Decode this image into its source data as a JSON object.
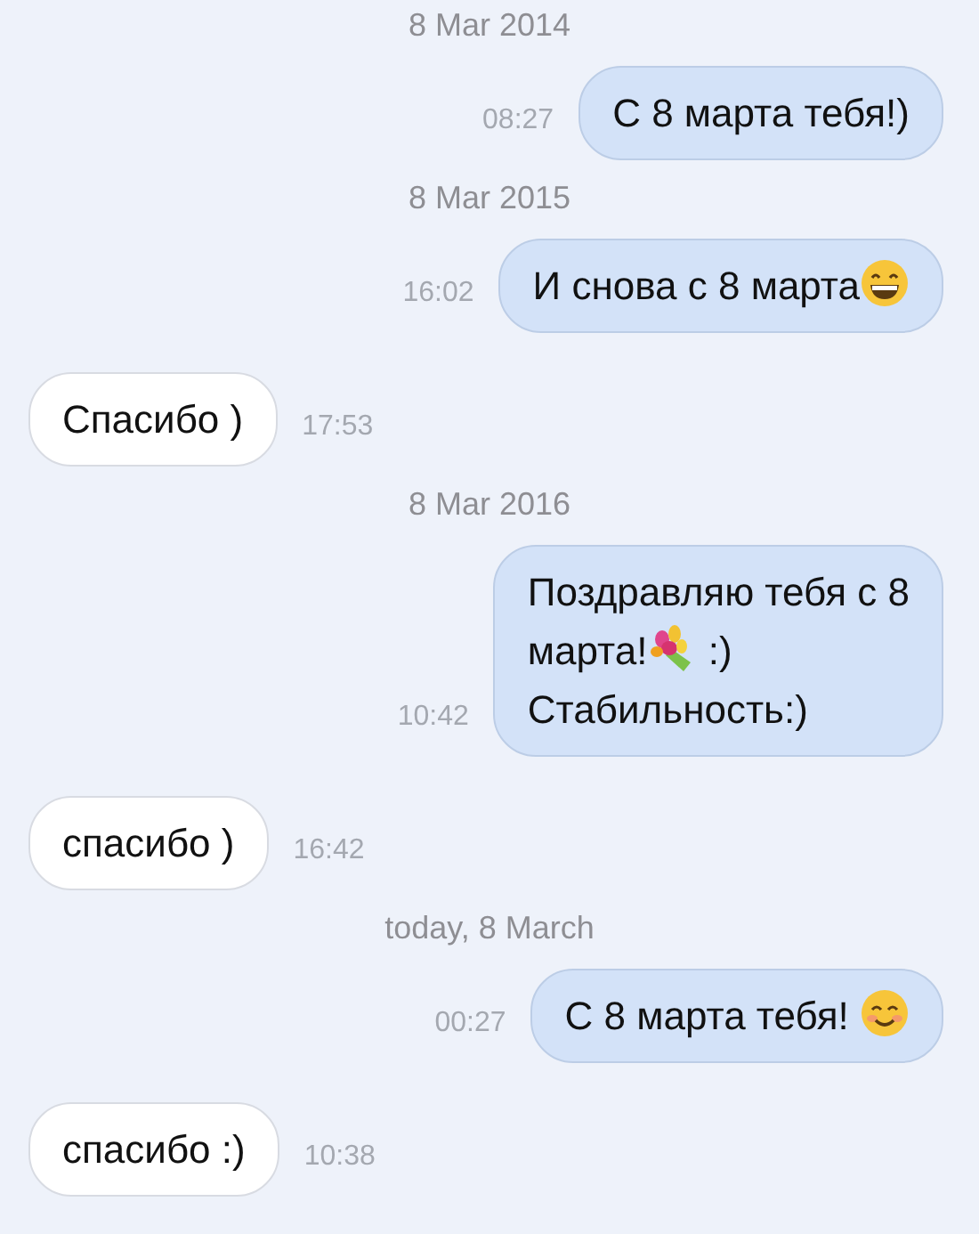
{
  "thread": [
    {
      "kind": "date",
      "text": "8 Mar 2014"
    },
    {
      "kind": "message",
      "outgoing": true,
      "time": "08:27",
      "lines": [
        [
          {
            "kind": "text",
            "text": "С 8 марта тебя!)"
          }
        ]
      ]
    },
    {
      "kind": "date",
      "text": "8 Mar 2015"
    },
    {
      "kind": "message",
      "outgoing": true,
      "time": "16:02",
      "lines": [
        [
          {
            "kind": "text",
            "text": "И снова с 8 марта"
          },
          {
            "kind": "grin"
          }
        ]
      ]
    },
    {
      "kind": "message",
      "outgoing": false,
      "time": "17:53",
      "lines": [
        [
          {
            "kind": "text",
            "text": "Спасибо )"
          }
        ]
      ]
    },
    {
      "kind": "date",
      "text": "8 Mar 2016"
    },
    {
      "kind": "message",
      "outgoing": true,
      "time": "10:42",
      "lines": [
        [
          {
            "kind": "text",
            "text": "Поздравляю тебя с 8"
          }
        ],
        [
          {
            "kind": "text",
            "text": "марта!"
          },
          {
            "kind": "bouquet"
          },
          {
            "kind": "text",
            "text": " :)"
          }
        ],
        [
          {
            "kind": "text",
            "text": "Стабильность:)"
          }
        ]
      ]
    },
    {
      "kind": "message",
      "outgoing": false,
      "time": "16:42",
      "lines": [
        [
          {
            "kind": "text",
            "text": "спасибо )"
          }
        ]
      ]
    },
    {
      "kind": "date",
      "text": "today, 8 March"
    },
    {
      "kind": "message",
      "outgoing": true,
      "time": "00:27",
      "lines": [
        [
          {
            "kind": "text",
            "text": "С 8 марта тебя! "
          },
          {
            "kind": "smile"
          }
        ]
      ]
    },
    {
      "kind": "message",
      "outgoing": false,
      "time": "10:38",
      "lines": [
        [
          {
            "kind": "text",
            "text": "спасибо :)"
          }
        ]
      ]
    }
  ]
}
